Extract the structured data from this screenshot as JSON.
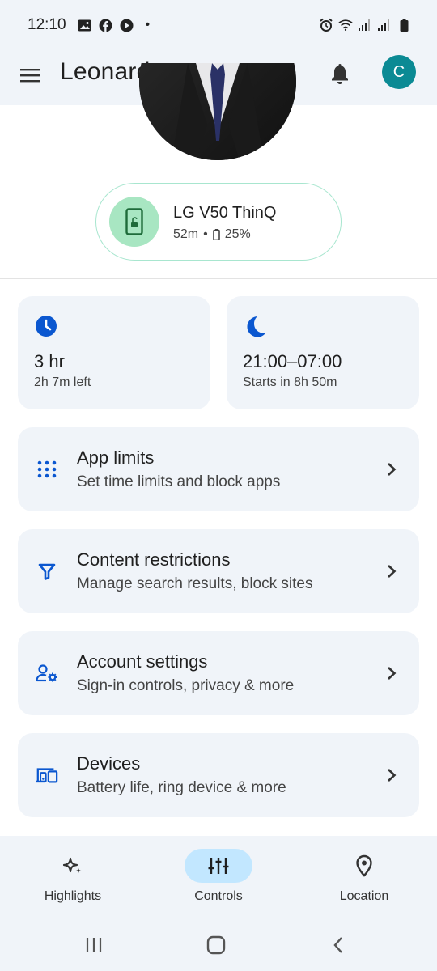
{
  "status_bar": {
    "time": "12:10",
    "dot": "•",
    "left_icons": [
      "gallery-icon",
      "facebook-icon",
      "play-icon"
    ],
    "right_icons": [
      "alarm-icon",
      "wifi-icon",
      "signal-icon",
      "signal-icon",
      "battery-icon"
    ]
  },
  "app_bar": {
    "title": "Leonard",
    "avatar_letter": "C",
    "avatar_color": "#0b8a94"
  },
  "device": {
    "name": "LG V50 ThinQ",
    "usage": "52m",
    "separator": "•",
    "battery": "25%",
    "icon": "phone-unlocked-icon",
    "accent": "#a8e6c2"
  },
  "summary_cards": [
    {
      "icon": "clock-icon",
      "value": "3 hr",
      "detail": "2h 7m left"
    },
    {
      "icon": "moon-icon",
      "value": "21:00–07:00",
      "detail": "Starts in 8h 50m"
    }
  ],
  "settings_rows": [
    {
      "icon": "grid-icon",
      "title": "App limits",
      "subtitle": "Set time limits and block apps"
    },
    {
      "icon": "filter-icon",
      "title": "Content restrictions",
      "subtitle": "Manage search results, block sites"
    },
    {
      "icon": "manage-account-icon",
      "title": "Account settings",
      "subtitle": "Sign-in controls, privacy & more"
    },
    {
      "icon": "devices-icon",
      "title": "Devices",
      "subtitle": "Battery life, ring device & more"
    }
  ],
  "bottom_nav": [
    {
      "label": "Highlights",
      "icon": "sparkle-icon",
      "active": false
    },
    {
      "label": "Controls",
      "icon": "tune-icon",
      "active": true
    },
    {
      "label": "Location",
      "icon": "location-pin-icon",
      "active": false
    }
  ],
  "colors": {
    "accent_blue": "#0b57d0",
    "surface": "#f0f4f9",
    "active_pill": "#c2e7ff"
  }
}
